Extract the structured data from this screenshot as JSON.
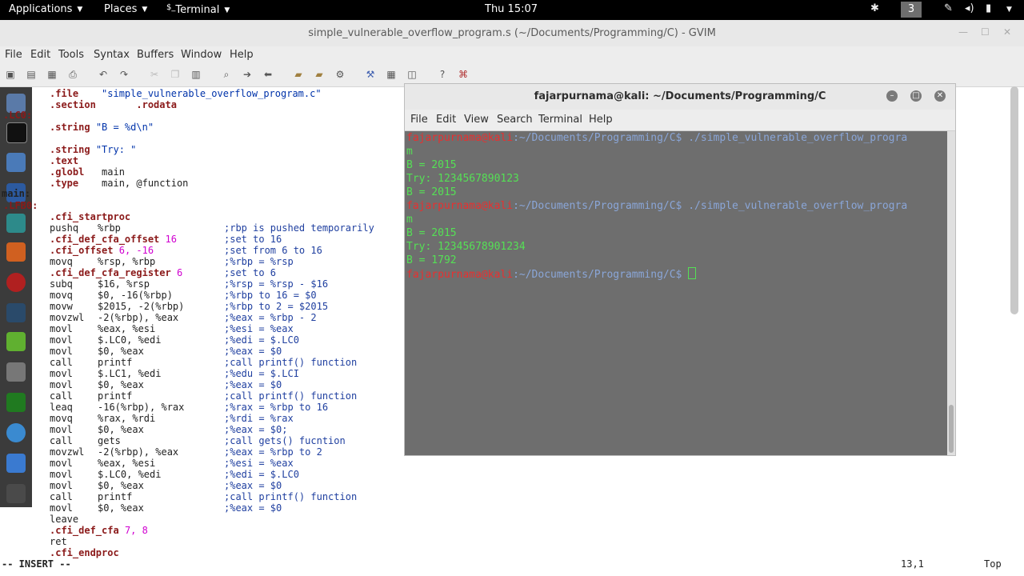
{
  "topbar": {
    "applications": "Applications",
    "places": "Places",
    "terminal": "Terminal",
    "clock": "Thu 15:07",
    "workspace": "3"
  },
  "gvim": {
    "title": "simple_vulnerable_overflow_program.s (~/Documents/Programming/C) - GVIM",
    "menu": [
      "File",
      "Edit",
      "Tools",
      "Syntax",
      "Buffers",
      "Window",
      "Help"
    ],
    "toolbar_icons": [
      "open-icon",
      "save-session-icon",
      "save-icon",
      "print-icon",
      "undo-icon",
      "redo-icon",
      "cut-icon",
      "copy-icon",
      "paste-icon",
      "find-icon",
      "find-next-icon",
      "find-prev-icon",
      "load-session-icon",
      "save-session2-icon",
      "run-icon",
      "make-icon",
      "tag-icon",
      "shell-icon",
      "help-icon",
      "search-help-icon"
    ],
    "side_labels": [
      ".LC0:",
      "main:",
      ".LFB0:"
    ],
    "lines": [
      {
        "a": ".file",
        "b": "\"simple_vulnerable_overflow_program.c\"",
        "c": ""
      },
      {
        "a": ".section",
        "b": "       .rodata",
        "c": ""
      },
      {
        "a": "",
        "b": "",
        "c": ""
      },
      {
        "a": ".string",
        "b": "\"B = %d\\n\"",
        "c": ""
      },
      {
        "a": "",
        "b": "",
        "c": ""
      },
      {
        "a": ".string",
        "b": "\"Try: \"",
        "c": ""
      },
      {
        "a": ".text",
        "b": "",
        "c": ""
      },
      {
        "a": ".globl",
        "b": "main",
        "c": ""
      },
      {
        "a": ".type",
        "b": "main, @function",
        "c": ""
      },
      {
        "a": "",
        "b": "",
        "c": ""
      },
      {
        "a": "",
        "b": "",
        "c": ""
      },
      {
        "a": ".cfi_startproc",
        "b": "",
        "c": ""
      },
      {
        "a": "pushq",
        "b": "%rbp",
        "c": ";rbp is pushed temporarily"
      },
      {
        "a": ".cfi_def_cfa_offset",
        "b": "16",
        "c": ";set to 16"
      },
      {
        "a": ".cfi_offset",
        "b": "6, -16",
        "c": ";set from 6 to 16"
      },
      {
        "a": "movq",
        "b": "%rsp, %rbp",
        "c": ";%rbp = %rsp"
      },
      {
        "a": ".cfi_def_cfa_register",
        "b": "6",
        "c": ";set to 6"
      },
      {
        "a": "subq",
        "b": "$16, %rsp",
        "c": ";%rsp = %rsp - $16"
      },
      {
        "a": "movq",
        "b": "$0, -16(%rbp)",
        "c": ";%rbp to 16 = $0"
      },
      {
        "a": "movw",
        "b": "$2015, -2(%rbp)",
        "c": ";%rbp to 2 = $2015"
      },
      {
        "a": "movzwl",
        "b": "-2(%rbp), %eax",
        "c": ";%eax = %rbp - 2"
      },
      {
        "a": "movl",
        "b": "%eax, %esi",
        "c": ";%esi = %eax"
      },
      {
        "a": "movl",
        "b": "$.LC0, %edi",
        "c": ";%edi = $.LC0"
      },
      {
        "a": "movl",
        "b": "$0, %eax",
        "c": ";%eax = $0"
      },
      {
        "a": "call",
        "b": "printf",
        "c": ";call printf() function"
      },
      {
        "a": "movl",
        "b": "$.LC1, %edi",
        "c": ";%edu = $.LCI"
      },
      {
        "a": "movl",
        "b": "$0, %eax",
        "c": ";%eax = $0"
      },
      {
        "a": "call",
        "b": "printf",
        "c": ";call printf() function"
      },
      {
        "a": "leaq",
        "b": "-16(%rbp), %rax",
        "c": ";%rax = %rbp to 16"
      },
      {
        "a": "movq",
        "b": "%rax, %rdi",
        "c": ";%rdi = %rax"
      },
      {
        "a": "movl",
        "b": "$0, %eax",
        "c": ";%eax = $0;"
      },
      {
        "a": "call",
        "b": "gets",
        "c": ";call gets() fucntion"
      },
      {
        "a": "movzwl",
        "b": "-2(%rbp), %eax",
        "c": ";%eax = %rbp to 2"
      },
      {
        "a": "movl",
        "b": "%eax, %esi",
        "c": ";%esi = %eax"
      },
      {
        "a": "movl",
        "b": "$.LC0, %edi",
        "c": ";%edi = $.LC0"
      },
      {
        "a": "movl",
        "b": "$0, %eax",
        "c": ";%eax = $0"
      },
      {
        "a": "call",
        "b": "printf",
        "c": ";call printf() function"
      },
      {
        "a": "movl",
        "b": "$0, %eax",
        "c": ";%eax = $0"
      },
      {
        "a": "leave",
        "b": "",
        "c": ""
      },
      {
        "a": ".cfi_def_cfa",
        "b": "7, 8",
        "c": ""
      },
      {
        "a": "ret",
        "b": "",
        "c": ""
      },
      {
        "a": ".cfi_endproc",
        "b": "",
        "c": ""
      }
    ],
    "mode": "-- INSERT --",
    "position": "13,1",
    "scroll": "Top"
  },
  "terminal": {
    "title": "fajarpurnama@kali: ~/Documents/Programming/C",
    "menu": [
      "File",
      "Edit",
      "View",
      "Search",
      "Terminal",
      "Help"
    ],
    "user": "fajarpurnama@kali",
    "path": ":~/Documents/Programming/C$",
    "lines": [
      {
        "kind": "prompt",
        "cmd": " ./simple_vulnerable_overflow_progra"
      },
      {
        "kind": "out",
        "text": "m"
      },
      {
        "kind": "out",
        "text": "B = 2015"
      },
      {
        "kind": "out",
        "text": "Try: 1234567890123"
      },
      {
        "kind": "out",
        "text": "B = 2015"
      },
      {
        "kind": "prompt",
        "cmd": " ./simple_vulnerable_overflow_progra"
      },
      {
        "kind": "out",
        "text": "m"
      },
      {
        "kind": "out",
        "text": "B = 2015"
      },
      {
        "kind": "out",
        "text": "Try: 12345678901234"
      },
      {
        "kind": "out",
        "text": "B = 1792"
      },
      {
        "kind": "prompt",
        "cmd": " "
      }
    ]
  },
  "colors": {
    "terminal_bg": "#6e6e6e",
    "prompt_user": "#e83030",
    "prompt_path": "#8aa6d8",
    "output": "#55e055"
  }
}
